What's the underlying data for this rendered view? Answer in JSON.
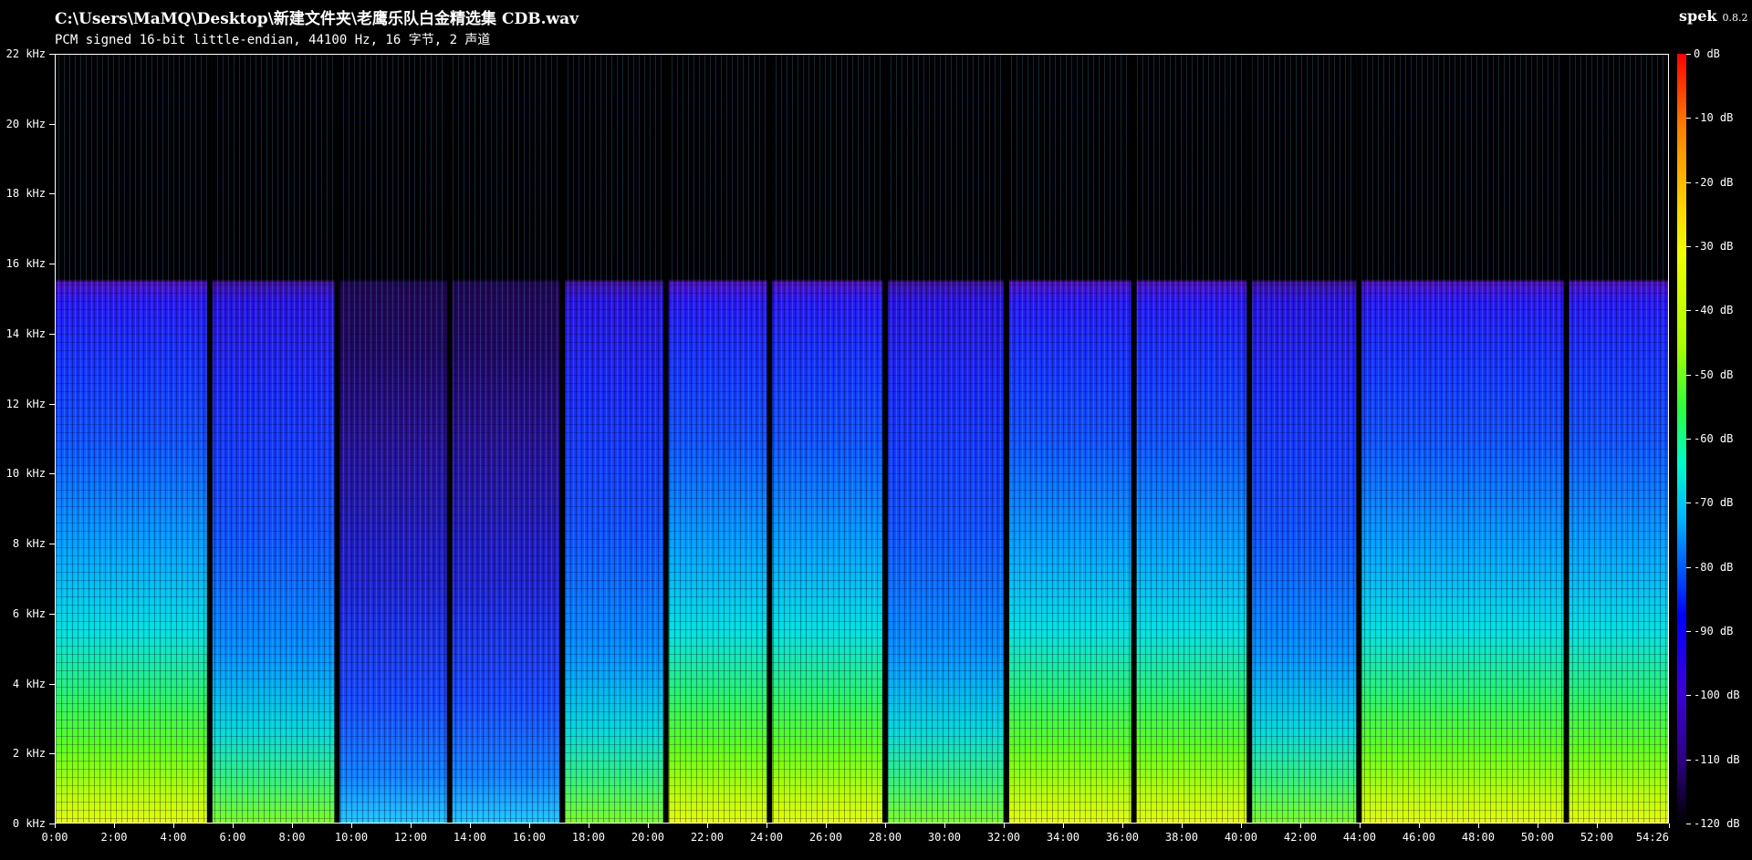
{
  "header": {
    "file_path": "C:\\Users\\MaMQ\\Desktop\\新建文件夹\\老鹰乐队白金精选集 CDB.wav",
    "audio_info": "PCM signed 16-bit little-endian, 44100 Hz, 16 字节, 2 声道",
    "app_name": "spek",
    "app_version": "0.8.2"
  },
  "frequency_axis": {
    "labels": [
      "22 kHz",
      "20 kHz",
      "18 kHz",
      "16 kHz",
      "14 kHz",
      "12 kHz",
      "10 kHz",
      "8 kHz",
      "6 kHz",
      "4 kHz",
      "2 kHz",
      "0 kHz"
    ],
    "values_khz": [
      22,
      20,
      18,
      16,
      14,
      12,
      10,
      8,
      6,
      4,
      2,
      0
    ]
  },
  "time_axis": {
    "labels": [
      "0:00",
      "2:00",
      "4:00",
      "6:00",
      "8:00",
      "10:00",
      "12:00",
      "14:00",
      "16:00",
      "18:00",
      "20:00",
      "22:00",
      "24:00",
      "26:00",
      "28:00",
      "30:00",
      "32:00",
      "34:00",
      "36:00",
      "38:00",
      "40:00",
      "42:00",
      "44:00",
      "46:00",
      "48:00",
      "50:00",
      "52:00",
      "54:26"
    ],
    "values_min": [
      0,
      2,
      4,
      6,
      8,
      10,
      12,
      14,
      16,
      18,
      20,
      22,
      24,
      26,
      28,
      30,
      32,
      34,
      36,
      38,
      40,
      42,
      44,
      46,
      48,
      50,
      52,
      54.433
    ],
    "duration_min": 54.433
  },
  "colorbar": {
    "labels": [
      "0 dB",
      "-10 dB",
      "-20 dB",
      "-30 dB",
      "-40 dB",
      "-50 dB",
      "-60 dB",
      "-70 dB",
      "-80 dB",
      "-90 dB",
      "-100 dB",
      "-110 dB",
      "-120 dB"
    ],
    "values_db": [
      0,
      -10,
      -20,
      -30,
      -40,
      -50,
      -60,
      -70,
      -80,
      -90,
      -100,
      -110,
      -120
    ]
  },
  "spectrogram": {
    "cutoff_khz": 15.5,
    "track_breaks_min": [
      5.2,
      9.5,
      13.3,
      17.1,
      20.6,
      24.1,
      28.0,
      32.1,
      36.4,
      40.3,
      44.0,
      51.0
    ],
    "quiet_tracks_min": [
      [
        9.5,
        17.1
      ]
    ]
  }
}
